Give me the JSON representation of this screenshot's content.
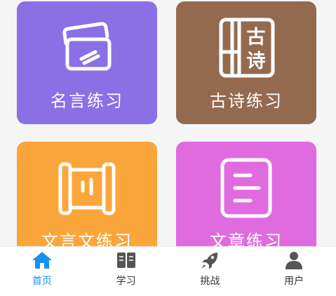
{
  "colors": {
    "card_quotes": "#8a70e4",
    "card_poems": "#946a4f",
    "card_classical": "#fba63a",
    "card_essays": "#e06be0",
    "tab_active": "#1a8ff0",
    "tab_inactive": "#555555"
  },
  "cards": [
    {
      "label": "名言练习",
      "icon": "cards-icon"
    },
    {
      "label": "古诗练习",
      "icon": "poem-book-icon",
      "icon_text": [
        "古",
        "诗"
      ]
    },
    {
      "label": "文言文练习",
      "icon": "scroll-icon"
    },
    {
      "label": "文章练习",
      "icon": "document-icon"
    }
  ],
  "tabs": [
    {
      "label": "首页",
      "icon": "home-icon",
      "active": true
    },
    {
      "label": "学习",
      "icon": "book-icon",
      "active": false
    },
    {
      "label": "挑战",
      "icon": "rocket-icon",
      "active": false
    },
    {
      "label": "用户",
      "icon": "user-icon",
      "active": false
    }
  ]
}
